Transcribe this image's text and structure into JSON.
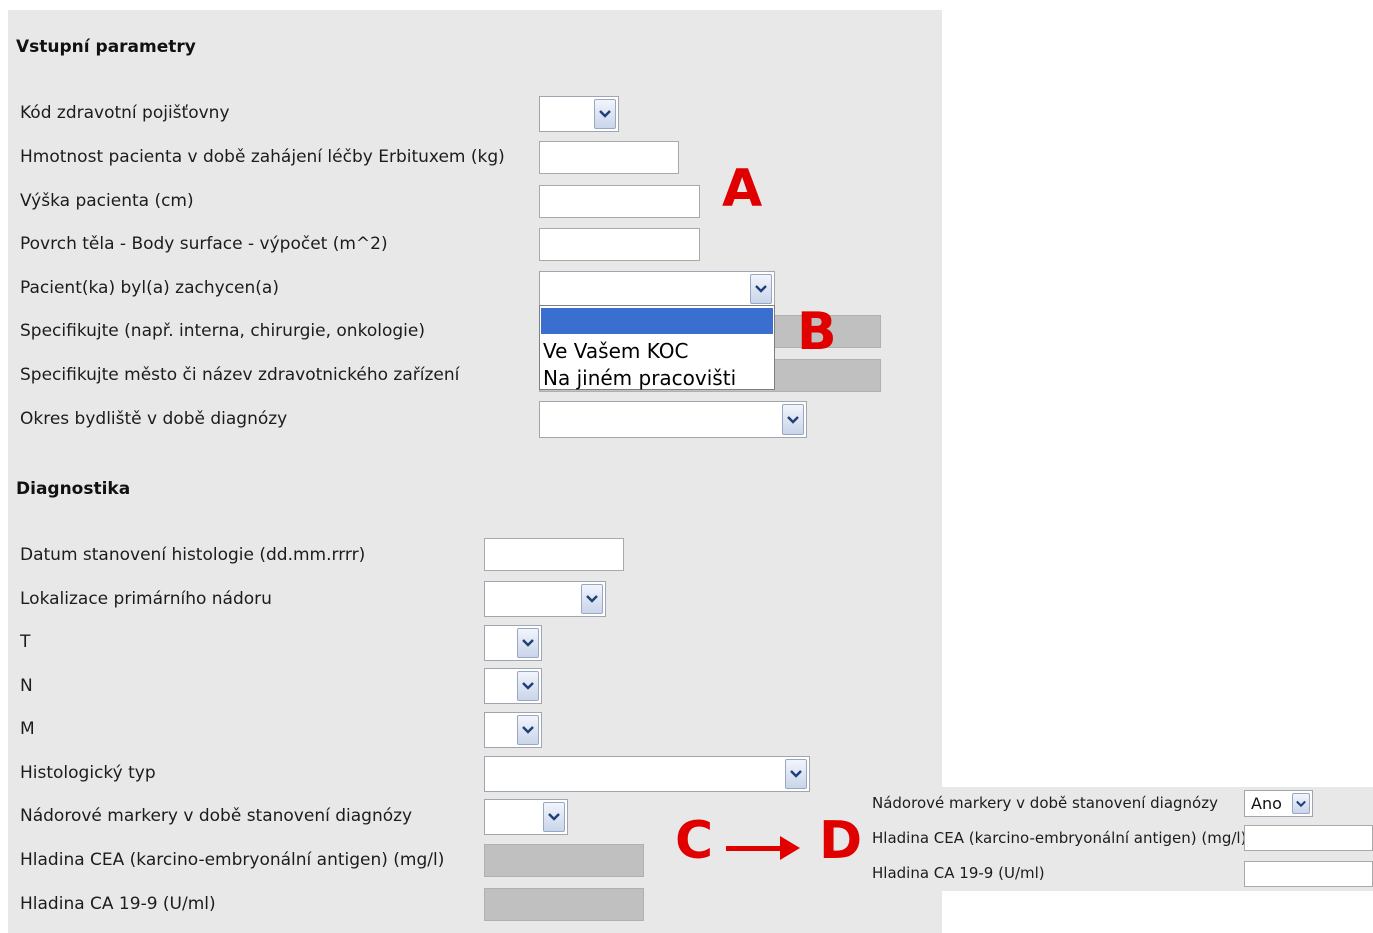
{
  "section_input": {
    "title": "Vstupní parametry",
    "fields": {
      "insurance_code": "Kód zdravotní pojišťovny",
      "weight": "Hmotnost pacienta v době zahájení léčby Erbituxem (kg)",
      "height": "Výška pacienta (cm)",
      "body_surface": "Povrch těla - Body surface - výpočet (m^2)",
      "captured": "Pacient(ka) byl(a) zachycen(a)",
      "specify_dept": "Specifikujte (např. interna, chirurgie, onkologie)",
      "specify_city": "Specifikujte město či název zdravotnického zařízení",
      "district": "Okres bydliště v době diagnózy"
    },
    "captured_options": [
      "",
      "Ve Vašem KOC",
      "Na jiném pracovišti"
    ]
  },
  "section_diag": {
    "title": "Diagnostika",
    "fields": {
      "histology_date": "Datum stanovení histologie (dd.mm.rrrr)",
      "primary_location": "Lokalizace primárního nádoru",
      "t": "T",
      "n": "N",
      "m": "M",
      "histology_type": "Histologický typ",
      "markers": "Nádorové markery v době stanovení diagnózy",
      "cea": "Hladina CEA (karcino-embryonální antigen) (mg/l)",
      "ca199": "Hladina CA 19-9 (U/ml)"
    }
  },
  "inset": {
    "markers": "Nádorové markery v době stanovení diagnózy",
    "markers_value": "Ano",
    "cea": "Hladina CEA (karcino-embryonální antigen) (mg/l)",
    "ca199": "Hladina CA 19-9 (U/ml)"
  },
  "annotations": {
    "a": "A",
    "b": "B",
    "c": "C",
    "d": "D"
  },
  "colors": {
    "marker_red": "#e00000",
    "highlight_blue": "#3a6fd0",
    "panel_gray": "#e8e8e8",
    "disabled_gray": "#c0c0c0"
  }
}
